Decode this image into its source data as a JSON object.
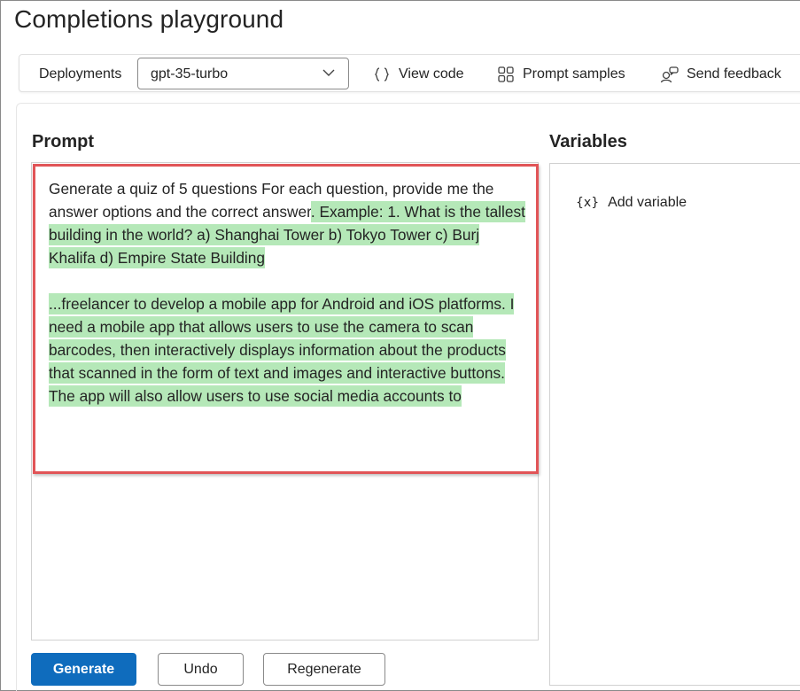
{
  "page": {
    "title": "Completions playground"
  },
  "toolbar": {
    "deployments_label": "Deployments",
    "deployment_value": "gpt-35-turbo",
    "view_code_label": "View code",
    "prompt_samples_label": "Prompt samples",
    "send_feedback_label": "Send feedback"
  },
  "prompt": {
    "title": "Prompt",
    "text_plain": "Generate a quiz of 5 questions For each question, provide me the answer options and the correct answer",
    "text_highlighted_1": ". Example: 1. What is the tallest building in the world? a) Shanghai Tower b) Tokyo Tower c) Burj Khalifa d) Empire State Building",
    "text_highlighted_2": "...freelancer to develop a mobile app for Android and iOS platforms. I need a mobile app that allows users to use the camera to scan barcodes, then interactively displays information about the products that scanned in the form of text and images and interactive buttons. The app will also allow users to use social media accounts to"
  },
  "variables": {
    "title": "Variables",
    "add_variable_icon_text": "{x}",
    "add_variable_label": "Add variable"
  },
  "actions": {
    "generate_label": "Generate",
    "undo_label": "Undo",
    "regenerate_label": "Regenerate"
  },
  "colors": {
    "accent": "#0f6cbd",
    "highlight": "#b5e8b8",
    "annotation_border": "#e15457"
  },
  "icons": {
    "deployment_dropdown": "chevron-down-icon",
    "view_code": "braces-icon",
    "prompt_samples": "grid-icon",
    "send_feedback": "feedback-icon",
    "add_variable": "variable-icon"
  }
}
